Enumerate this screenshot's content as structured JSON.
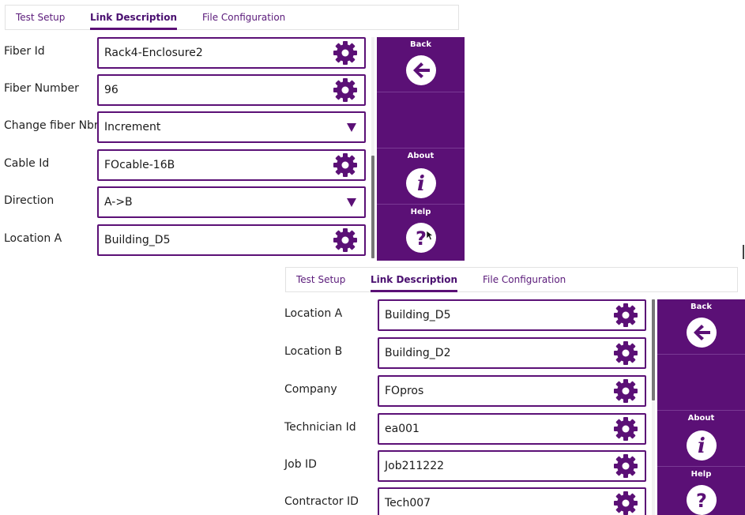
{
  "screens": [
    {
      "tabs": [
        {
          "label": "Test Setup",
          "active": false
        },
        {
          "label": "Link Description",
          "active": true
        },
        {
          "label": "File Configuration",
          "active": false
        }
      ],
      "fields": [
        {
          "label": "Fiber Id",
          "value": "Rack4-Enclosure2",
          "control": "gear"
        },
        {
          "label": "Fiber Number",
          "value": "96",
          "control": "gear"
        },
        {
          "label": "Change fiber Nbr",
          "value": "Increment",
          "control": "dropdown"
        },
        {
          "label": "Cable Id",
          "value": "FOcable-16B",
          "control": "gear"
        },
        {
          "label": "Direction",
          "value": "A->B",
          "control": "dropdown"
        },
        {
          "label": "Location A",
          "value": "Building_D5",
          "control": "gear"
        }
      ],
      "side_buttons": [
        {
          "label": "Back",
          "icon": "arrow-left-icon"
        },
        {
          "label": "",
          "icon": ""
        },
        {
          "label": "About",
          "icon": "info-icon"
        },
        {
          "label": "Help",
          "icon": "question-icon"
        }
      ]
    },
    {
      "tabs": [
        {
          "label": "Test Setup",
          "active": false
        },
        {
          "label": "Link Description",
          "active": true
        },
        {
          "label": "File Configuration",
          "active": false
        }
      ],
      "fields": [
        {
          "label": "Location A",
          "value": "Building_D5",
          "control": "gear"
        },
        {
          "label": "Location B",
          "value": "Building_D2",
          "control": "gear"
        },
        {
          "label": "Company",
          "value": "FOpros",
          "control": "gear"
        },
        {
          "label": "Technician Id",
          "value": "ea001",
          "control": "gear"
        },
        {
          "label": "Job ID",
          "value": "Job211222",
          "control": "gear"
        },
        {
          "label": "Contractor ID",
          "value": "Tech007",
          "control": "gear"
        }
      ],
      "side_buttons": [
        {
          "label": "Back",
          "icon": "arrow-left-icon"
        },
        {
          "label": "",
          "icon": ""
        },
        {
          "label": "About",
          "icon": "info-icon"
        },
        {
          "label": "Help",
          "icon": "question-icon"
        }
      ]
    }
  ],
  "colors": {
    "accent": "#5b1076",
    "tab_text": "#5a1a7a"
  }
}
